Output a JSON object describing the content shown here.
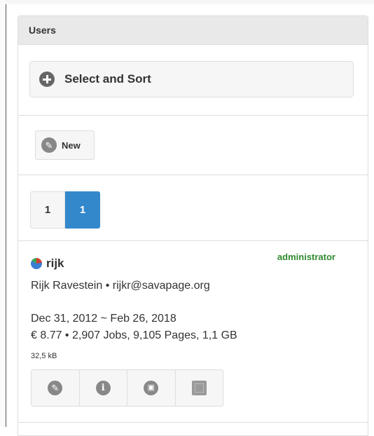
{
  "panel": {
    "title": "Users"
  },
  "select_sort": {
    "label": "Select and Sort",
    "icon": "plus-circle-icon"
  },
  "toolbar": {
    "new_label": "New",
    "new_icon": "pencil-icon"
  },
  "pager": {
    "first_label": "1",
    "current_label": "1"
  },
  "user": {
    "id": "rijk",
    "role": "administrator",
    "name_email": "Rijk Ravestein • rijkr@savapage.org",
    "dates": "Dec 31, 2012 ~ Feb 26, 2018",
    "stats": "€  8.77 • 2,907 Jobs, 9,105 Pages, 1,1 GB",
    "size": "32,5 kB",
    "actions": [
      {
        "icon": "edit-icon",
        "glyph": "✎"
      },
      {
        "icon": "info-icon",
        "glyph": "i"
      },
      {
        "icon": "bag-icon",
        "glyph": "▣"
      },
      {
        "icon": "dotted-square-icon",
        "glyph": ""
      }
    ]
  },
  "colors": {
    "accent": "#3388cc",
    "role": "#2f8a2f",
    "header_bg": "#e9e9e9"
  }
}
